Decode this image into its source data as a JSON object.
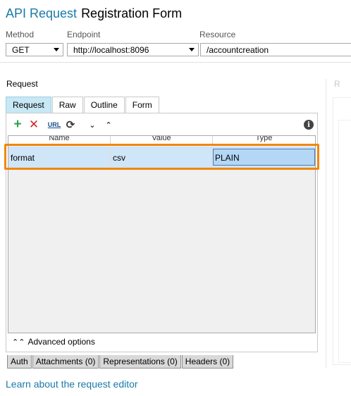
{
  "header": {
    "kind": "API Request",
    "name": "Registration Form"
  },
  "fields": {
    "method_label": "Method",
    "method_value": "GET",
    "endpoint_label": "Endpoint",
    "endpoint_value": "http://localhost:8096",
    "resource_label": "Resource",
    "resource_value": "/accountcreation"
  },
  "request_panel": {
    "title": "Request",
    "right_title": "R"
  },
  "tabs": [
    "Request",
    "Raw",
    "Outline",
    "Form"
  ],
  "active_tab": "Request",
  "toolbar": {
    "icons": [
      "add-icon",
      "delete-icon",
      "url-icon",
      "refresh-icon",
      "move-down-icon",
      "move-up-icon",
      "info-icon"
    ],
    "add": "+",
    "delete": "✕",
    "url": "URL",
    "refresh": "⟳",
    "down": "⌄",
    "up": "⌃",
    "info": "i"
  },
  "params_table": {
    "columns": [
      "Name",
      "Value",
      "Type"
    ],
    "rows": [
      {
        "name": "format",
        "value": "csv",
        "type": "PLAIN"
      }
    ]
  },
  "advanced_options": "Advanced options",
  "advanced_chevron": "⌃⌃",
  "bottom_tabs": [
    "Auth",
    "Attachments (0)",
    "Representations (0)",
    "Headers (0)"
  ],
  "learn_link": "Learn about the request editor",
  "colors": {
    "accent": "#1a7aa8",
    "active_tab": "#c7e8f4",
    "selected_row": "#cfe5f8",
    "highlight": "#f0870f"
  }
}
